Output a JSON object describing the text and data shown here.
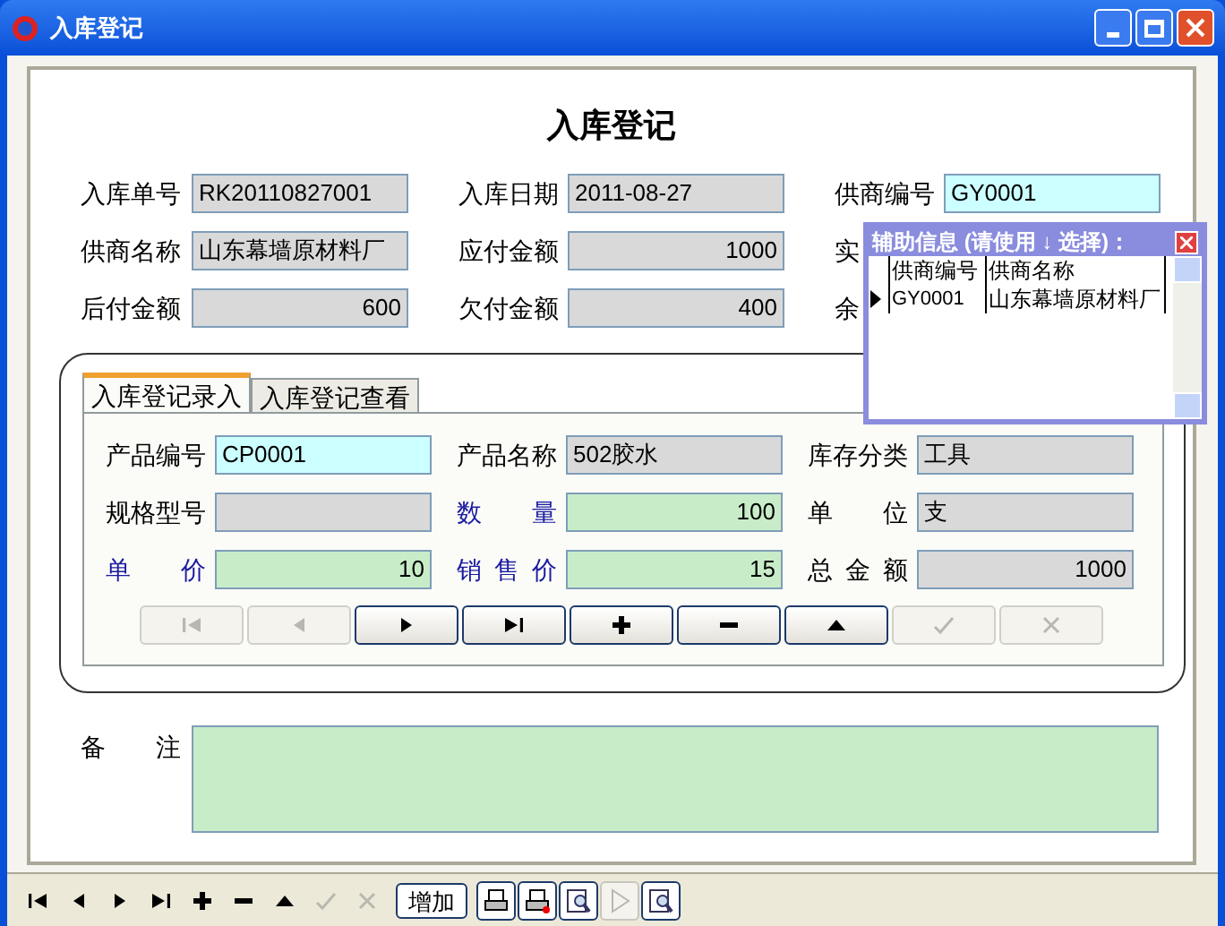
{
  "window": {
    "title": "入库登记"
  },
  "heading": "入库登记",
  "header_rows": [
    [
      {
        "label": "入库单号",
        "value": "RK20110827001",
        "kind": "readonly",
        "numeric": false
      },
      {
        "label": "入库日期",
        "value": "2011-08-27",
        "kind": "readonly",
        "numeric": false
      },
      {
        "label": "供商编号",
        "value": "GY0001",
        "kind": "lookup",
        "numeric": false
      }
    ],
    [
      {
        "label": "供商名称",
        "value": "山东幕墙原材料厂",
        "kind": "readonly",
        "numeric": false
      },
      {
        "label": "应付金额",
        "value": "1000",
        "kind": "readonly",
        "numeric": true
      },
      {
        "label": "实",
        "kind": "covered"
      }
    ],
    [
      {
        "label": "后付金额",
        "value": "600",
        "kind": "readonly",
        "numeric": true
      },
      {
        "label": "欠付金额",
        "value": "400",
        "kind": "readonly",
        "numeric": true
      },
      {
        "label": "余",
        "kind": "covered"
      }
    ]
  ],
  "tabs": [
    {
      "label": "入库登记录入",
      "selected": true
    },
    {
      "label": "入库登记查看",
      "selected": false
    }
  ],
  "detail_rows": [
    [
      {
        "label": "产品编号",
        "value": "CP0001",
        "kind": "lookup",
        "numeric": false,
        "emphasis": false
      },
      {
        "label": "产品名称",
        "value": "502胶水",
        "kind": "readonly",
        "numeric": false,
        "emphasis": false
      },
      {
        "label": "库存分类",
        "value": "工具",
        "kind": "readonly",
        "numeric": false,
        "emphasis": false
      }
    ],
    [
      {
        "label": "规格型号",
        "kind": "readonly",
        "emphasis": false
      },
      {
        "label": "数量",
        "value": "100",
        "kind": "input",
        "numeric": true,
        "emphasis": true
      },
      {
        "label": "单位",
        "value": "支",
        "kind": "readonly",
        "numeric": false,
        "emphasis": false
      }
    ],
    [
      {
        "label": "单价",
        "value": "10",
        "kind": "input",
        "numeric": true,
        "emphasis": true
      },
      {
        "label": "销售价",
        "value": "15",
        "kind": "input",
        "numeric": true,
        "emphasis": true
      },
      {
        "label": "总金额",
        "value": "1000",
        "kind": "readonly",
        "numeric": true,
        "emphasis": false
      }
    ]
  ],
  "nav_buttons": [
    {
      "kind": "first",
      "disabled": true
    },
    {
      "kind": "prev",
      "disabled": true
    },
    {
      "kind": "next",
      "disabled": false
    },
    {
      "kind": "last",
      "disabled": false
    },
    {
      "kind": "add",
      "disabled": false
    },
    {
      "kind": "delete",
      "disabled": false
    },
    {
      "kind": "up",
      "disabled": false
    },
    {
      "kind": "save",
      "disabled": true
    },
    {
      "kind": "cancel",
      "disabled": true
    }
  ],
  "remark": {
    "label": "备注"
  },
  "popup": {
    "title": "辅助信息 (请使用 ↓ 选择)：",
    "columns": [
      "供商编号",
      "供商名称"
    ],
    "rows": [
      {
        "cells": [
          "GY0001",
          "山东幕墙原材料厂"
        ],
        "selected": true
      }
    ]
  },
  "toolbar": [
    {
      "kind": "first",
      "disabled": false
    },
    {
      "kind": "prev",
      "disabled": false
    },
    {
      "kind": "next",
      "disabled": false
    },
    {
      "kind": "last",
      "disabled": false
    },
    {
      "kind": "add",
      "disabled": false
    },
    {
      "kind": "delete",
      "disabled": false
    },
    {
      "kind": "up",
      "disabled": false
    },
    {
      "kind": "save",
      "disabled": true
    },
    {
      "kind": "cancel",
      "disabled": true
    },
    {
      "kind": "text",
      "label": "增加",
      "disabled": false
    },
    {
      "kind": "print",
      "disabled": false
    },
    {
      "kind": "print-stop",
      "disabled": false
    },
    {
      "kind": "preview",
      "disabled": false
    },
    {
      "kind": "play",
      "disabled": true
    },
    {
      "kind": "find",
      "disabled": false
    }
  ]
}
